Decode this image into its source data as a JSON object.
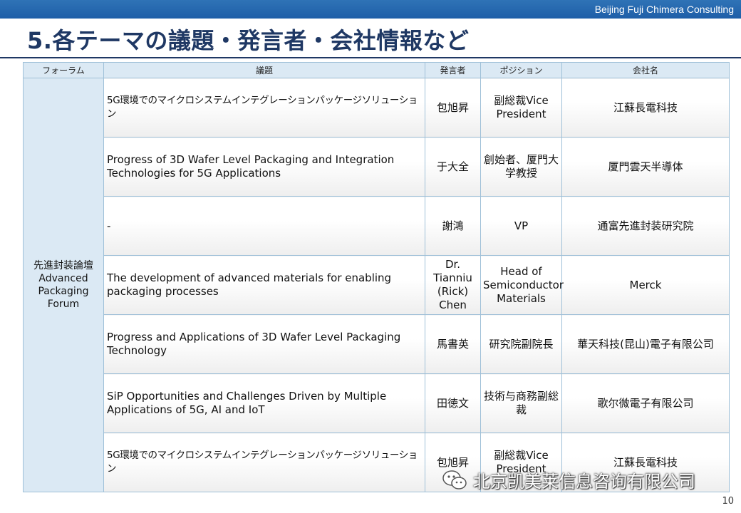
{
  "header": {
    "company": "Beijing Fuji Chimera Consulting",
    "title": "5.各テーマの議題・発言者・会社情報など"
  },
  "table": {
    "columns": [
      "フォーラム",
      "議題",
      "発言者",
      "ポジション",
      "会社名"
    ],
    "forum": [
      "先進封装論壇",
      "Advanced",
      "Packaging",
      "Forum"
    ],
    "rows": [
      {
        "topic": "5G環境でのマイクロシステムインテグレーションパッケージソリューション",
        "speaker": "包旭昇",
        "position": "副総裁Vice President",
        "company": "江蘇長電科技"
      },
      {
        "topic": "Progress of 3D Wafer Level Packaging and Integration Technologies for 5G Applications",
        "speaker": "于大全",
        "position": "創始者、厦門大学教授",
        "company": "厦門雲天半導体"
      },
      {
        "topic": "-",
        "speaker": "謝鴻",
        "position": "VP",
        "company": "通富先進封装研究院"
      },
      {
        "topic": "The development of advanced materials for enabling packaging processes",
        "speaker": "Dr. Tianniu (Rick) Chen",
        "position": "Head of Semiconductor Materials",
        "company": "Merck"
      },
      {
        "topic": "Progress and Applications of 3D Wafer Level Packaging Technology",
        "speaker": "馬書英",
        "position": "研究院副院長",
        "company": "華天科技(昆山)電子有限公司"
      },
      {
        "topic": "SiP Opportunities and Challenges Driven by Multiple Applications of 5G, AI and IoT",
        "speaker": "田徳文",
        "position": "技術与商務副総裁",
        "company": "歌尔微電子有限公司"
      },
      {
        "topic": "5G環境でのマイクロシステムインテグレーションパッケージソリューション",
        "speaker": "包旭昇",
        "position": "副総裁Vice President",
        "company": "江蘇長電科技"
      }
    ]
  },
  "watermark": {
    "text": "北京凯美莱信息咨询有限公司",
    "icon": "wechat-icon"
  },
  "page_number": "10",
  "colors": {
    "topbar": "#1e5ea8",
    "title": "#1f3864",
    "header_cell": "#dbe9f4",
    "border": "#9fc0d8"
  }
}
